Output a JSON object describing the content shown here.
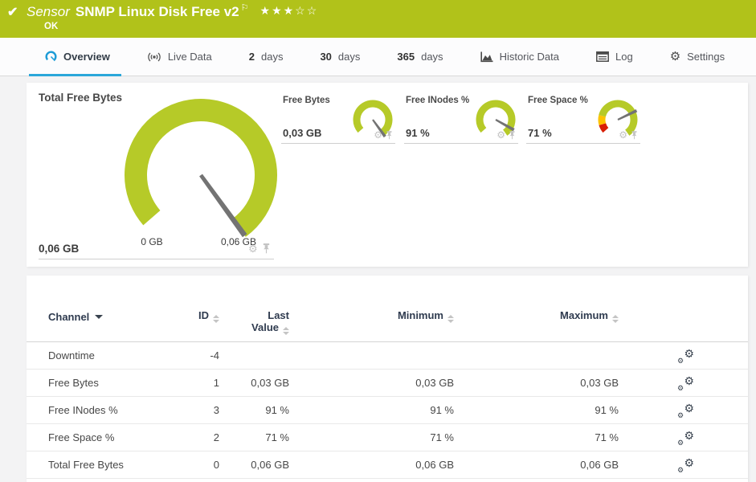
{
  "icons": {
    "gear": "⚙",
    "check": "✔",
    "flag": "⚐"
  },
  "colors": {
    "ok_green": "#b1c21a",
    "gauge_green": "#b6ca28",
    "warn_yellow": "#fdc300",
    "error_red": "#d81e05",
    "accent_blue": "#2ba7d9",
    "needle_gray": "#737373"
  },
  "header": {
    "kind": "Sensor",
    "title": "SNMP Linux Disk Free v2",
    "status": "OK",
    "rating": "★★★☆☆"
  },
  "tabs": [
    {
      "label": "Overview",
      "icon": "gauge-icon",
      "active": true
    },
    {
      "label": "Live Data",
      "icon": "broadcast-icon"
    },
    {
      "num": "2",
      "label": "days"
    },
    {
      "num": "30",
      "label": "days"
    },
    {
      "num": "365",
      "label": "days"
    },
    {
      "label": "Historic Data",
      "icon": "area-chart-icon"
    },
    {
      "label": "Log",
      "icon": "log-icon"
    },
    {
      "label": "Settings",
      "icon": "gear-icon"
    }
  ],
  "gauges": {
    "primary": {
      "title": "Total Free Bytes",
      "value": "0,06 GB",
      "scale_min": "0 GB",
      "scale_max": "0,06 GB",
      "needle_fraction": 1.0,
      "segments": [
        {
          "from": 0,
          "to": 1,
          "color": "#b6ca28"
        }
      ]
    },
    "small": [
      {
        "title": "Free Bytes",
        "value": "0,03 GB",
        "needle_fraction": 1.0,
        "segments": [
          {
            "from": 0,
            "to": 1,
            "color": "#b6ca28"
          }
        ]
      },
      {
        "title": "Free INodes %",
        "value": "91 %",
        "needle_fraction": 0.91,
        "segments": [
          {
            "from": 0,
            "to": 1,
            "color": "#b6ca28"
          }
        ]
      },
      {
        "title": "Free Space %",
        "value": "71 %",
        "needle_fraction": 0.71,
        "segments": [
          {
            "from": 0,
            "to": 0.09,
            "color": "#d81e05"
          },
          {
            "from": 0.09,
            "to": 0.2,
            "color": "#fdc300"
          },
          {
            "from": 0.2,
            "to": 1,
            "color": "#b6ca28"
          }
        ]
      }
    ]
  },
  "table": {
    "columns": {
      "channel": "Channel",
      "id": "ID",
      "last_line1": "Last",
      "last_line2": "Value",
      "minimum": "Minimum",
      "maximum": "Maximum"
    },
    "rows": [
      {
        "channel": "Downtime",
        "id": "-4",
        "last": "",
        "min": "",
        "max": ""
      },
      {
        "channel": "Free Bytes",
        "id": "1",
        "last": "0,03 GB",
        "min": "0,03 GB",
        "max": "0,03 GB"
      },
      {
        "channel": "Free INodes %",
        "id": "3",
        "last": "91 %",
        "min": "91 %",
        "max": "91 %"
      },
      {
        "channel": "Free Space %",
        "id": "2",
        "last": "71 %",
        "min": "71 %",
        "max": "71 %"
      },
      {
        "channel": "Total Free Bytes",
        "id": "0",
        "last": "0,06 GB",
        "min": "0,06 GB",
        "max": "0,06 GB"
      }
    ]
  }
}
